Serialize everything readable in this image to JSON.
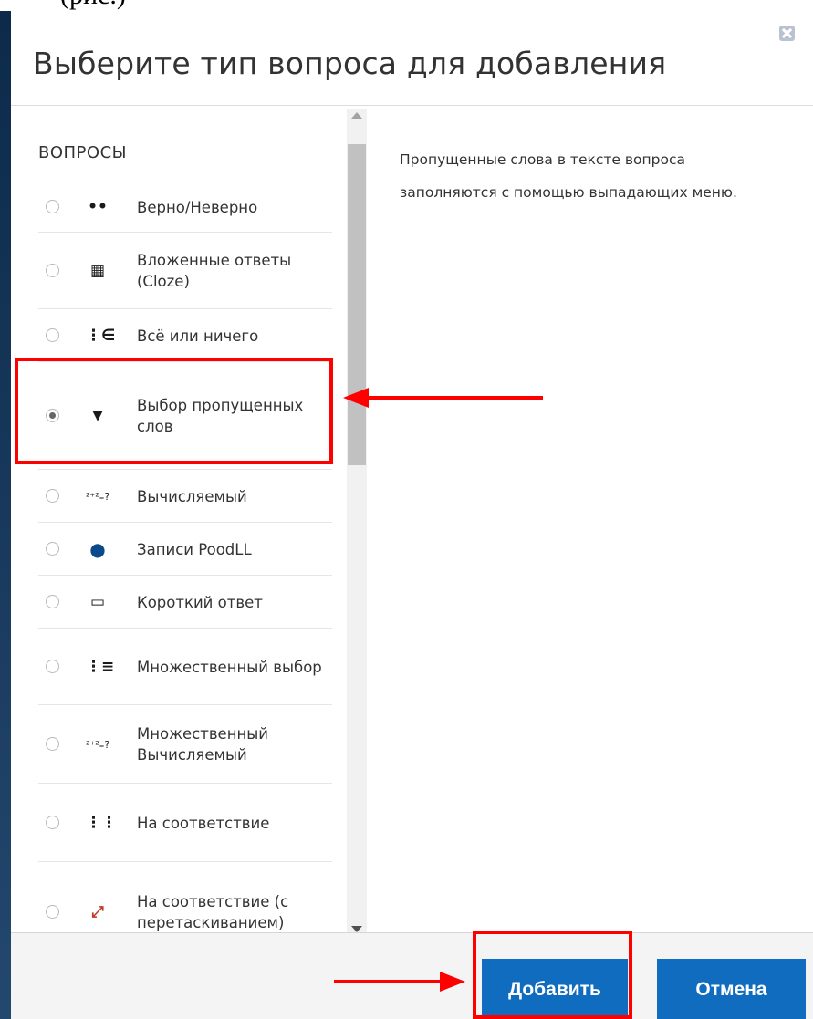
{
  "background": {
    "partial_text": "(рис.)"
  },
  "dialog": {
    "title": "Выберите тип вопроса для добавления",
    "close_icon": "close-icon"
  },
  "list": {
    "heading": "ВОПРОСЫ",
    "options": [
      {
        "icon": "••",
        "icon_name": "true-false-icon",
        "label": "Верно/Неверно",
        "checked": false
      },
      {
        "icon": "▦",
        "icon_name": "cloze-icon",
        "label": "Вложенные ответы (Cloze)",
        "checked": false
      },
      {
        "icon": "⋮∈",
        "icon_name": "all-or-nothing-icon",
        "label": "Всё или ничего",
        "checked": false
      },
      {
        "icon": "▼",
        "icon_name": "select-missing-words-icon",
        "label": "Выбор пропущенных слов",
        "checked": true
      },
      {
        "icon": "²⁺²₌?",
        "icon_name": "calculated-icon",
        "label": "Вычисляемый",
        "checked": false
      },
      {
        "icon": "●",
        "icon_name": "poodll-record-icon",
        "label": "Записи PoodLL",
        "checked": false
      },
      {
        "icon": "▭",
        "icon_name": "short-answer-icon",
        "label": "Короткий ответ",
        "checked": false
      },
      {
        "icon": "⋮≡",
        "icon_name": "multichoice-icon",
        "label": "Множественный выбор",
        "checked": false
      },
      {
        "icon": "²⁺²₌?",
        "icon_name": "calculated-multi-icon",
        "label": "Множественный Вычисляемый",
        "checked": false
      },
      {
        "icon": "⋮⋮",
        "icon_name": "matching-icon",
        "label": "На соответствие",
        "checked": false
      },
      {
        "icon": "⤢",
        "icon_name": "drag-match-icon",
        "label": "На соответствие (с перетаскиванием)",
        "checked": false
      }
    ]
  },
  "description": "Пропущенные слова в тексте вопроса заполняются с помощью выпадающих меню.",
  "footer": {
    "add_label": "Добавить",
    "cancel_label": "Отмена"
  },
  "colors": {
    "primary_button": "#0f6cbf",
    "annotation": "#ff0000"
  }
}
